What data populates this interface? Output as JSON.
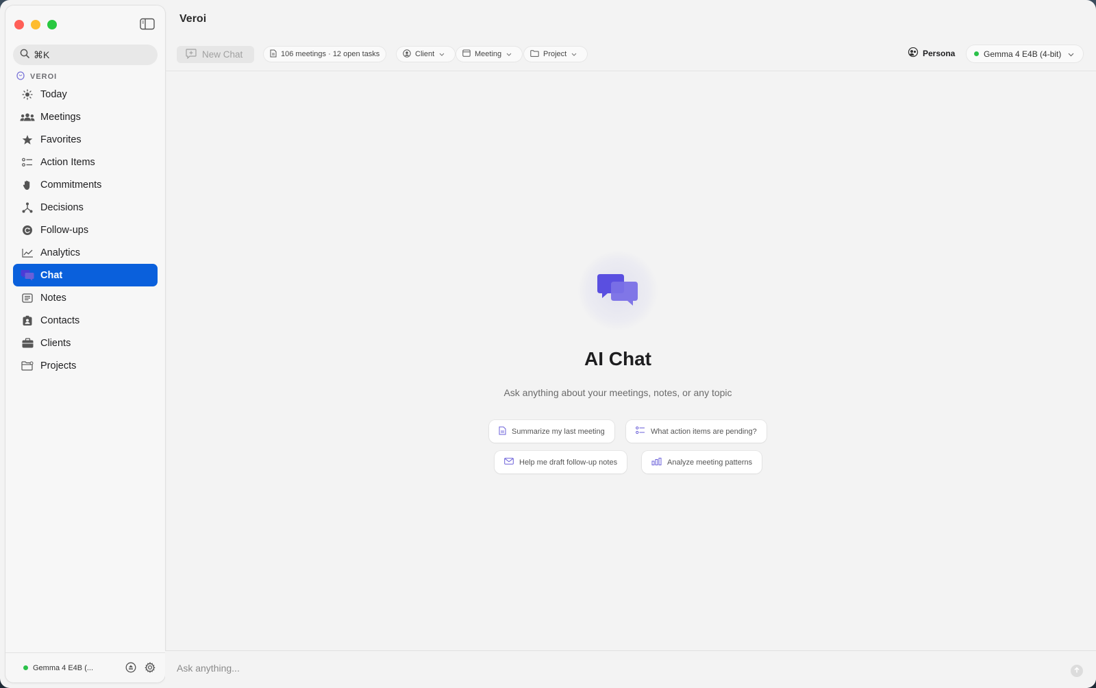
{
  "app": {
    "title": "Veroi"
  },
  "sidebar": {
    "search_placeholder": "⌘K",
    "section_label": "VEROI",
    "items": [
      {
        "label": "Today",
        "icon": "sun-icon"
      },
      {
        "label": "Meetings",
        "icon": "people-icon"
      },
      {
        "label": "Favorites",
        "icon": "star-icon"
      },
      {
        "label": "Action Items",
        "icon": "checklist-icon"
      },
      {
        "label": "Commitments",
        "icon": "hand-icon"
      },
      {
        "label": "Decisions",
        "icon": "branch-icon"
      },
      {
        "label": "Follow-ups",
        "icon": "refresh-icon"
      },
      {
        "label": "Analytics",
        "icon": "chart-line-icon"
      },
      {
        "label": "Chat",
        "icon": "chat-bubbles-icon",
        "active": true
      },
      {
        "label": "Notes",
        "icon": "note-icon"
      },
      {
        "label": "Contacts",
        "icon": "contact-card-icon"
      },
      {
        "label": "Clients",
        "icon": "briefcase-icon"
      },
      {
        "label": "Projects",
        "icon": "folder-icon"
      }
    ],
    "footer": {
      "model_label": "Gemma 4 E4B (...",
      "status_color": "#2bc14a"
    }
  },
  "toolbar": {
    "new_chat_label": "New Chat",
    "stats_label": "106 meetings · 12 open tasks",
    "client_label": "Client",
    "meeting_label": "Meeting",
    "project_label": "Project",
    "persona_label": "Persona",
    "model_label": "Gemma 4 E4B (4-bit)"
  },
  "hero": {
    "title": "AI Chat",
    "subtitle": "Ask anything about your meetings, notes, or any topic",
    "suggestions": [
      {
        "label": "Summarize my last meeting",
        "icon": "document-icon"
      },
      {
        "label": "What action items are pending?",
        "icon": "checklist-icon"
      },
      {
        "label": "Help me draft follow-up notes",
        "icon": "envelope-icon"
      },
      {
        "label": "Analyze meeting patterns",
        "icon": "bar-chart-icon"
      }
    ]
  },
  "composer": {
    "placeholder": "Ask anything..."
  },
  "colors": {
    "accent": "#0a60dc",
    "chat_icon": "#6a5fd8",
    "status_green": "#2bc14a"
  }
}
